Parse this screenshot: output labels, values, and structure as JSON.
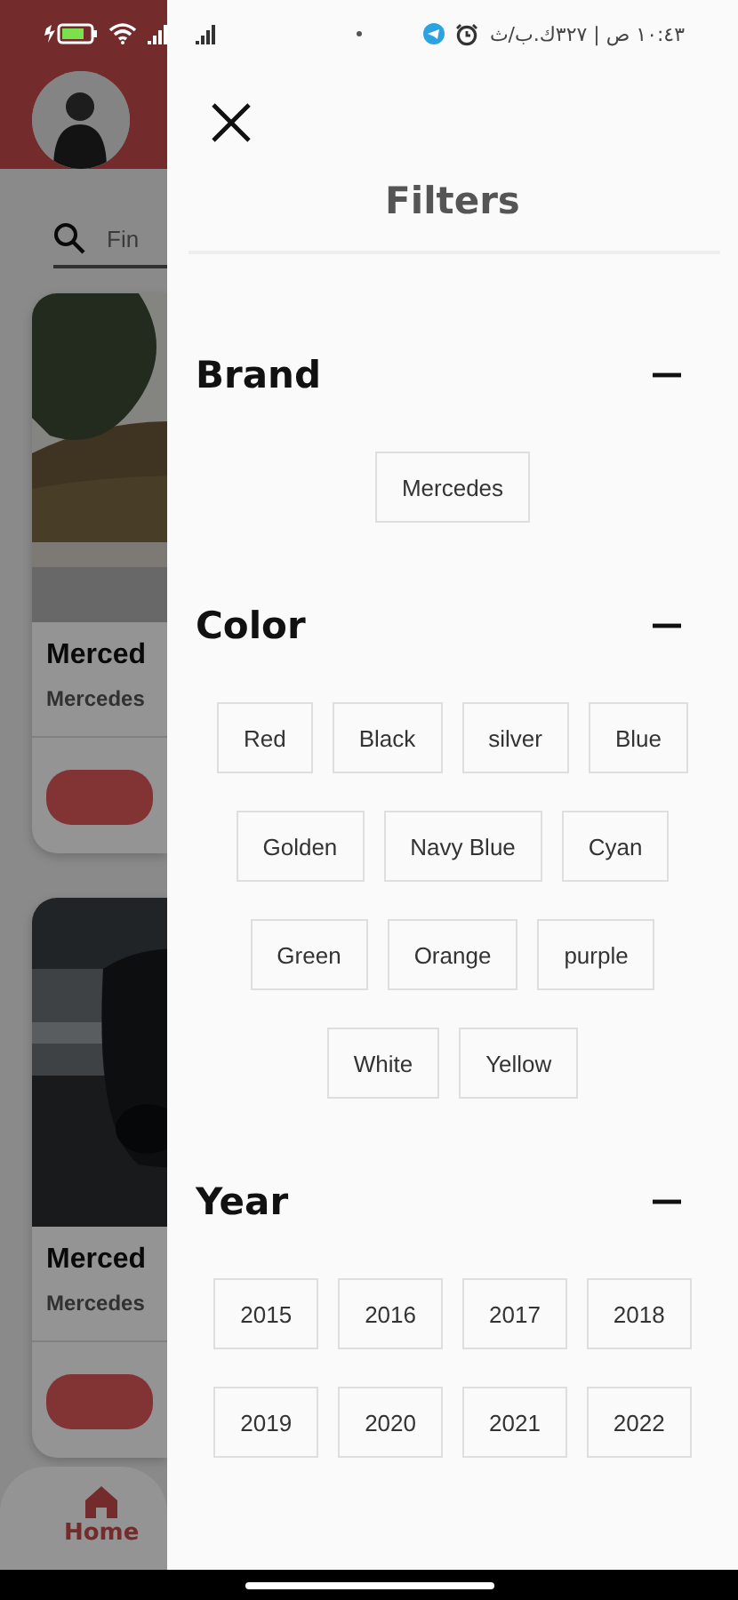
{
  "status_bar": {
    "network_speed": "١٠:٤٣ ص | ٣٢٧ك.ب/ث"
  },
  "background": {
    "search": {
      "placeholder": "Fin"
    },
    "cards": [
      {
        "kind": "trees",
        "title": "Merced",
        "subtitle": "Mercedes"
      },
      {
        "kind": "car",
        "title": "Merced",
        "subtitle": "Mercedes"
      }
    ],
    "nav": [
      {
        "label": "Home",
        "selected": true
      }
    ]
  },
  "filters": {
    "title": "Filters",
    "sections": [
      {
        "title": "Brand",
        "expanded": true,
        "options": [
          {
            "label": "Mercedes",
            "selected": false
          }
        ]
      },
      {
        "title": "Color",
        "expanded": true,
        "options": [
          {
            "label": "Red",
            "selected": false
          },
          {
            "label": "Black",
            "selected": false
          },
          {
            "label": "silver",
            "selected": false
          },
          {
            "label": "Blue",
            "selected": false
          },
          {
            "label": "Golden",
            "selected": false
          },
          {
            "label": "Navy Blue",
            "selected": false
          },
          {
            "label": "Cyan",
            "selected": false
          },
          {
            "label": "Green",
            "selected": false
          },
          {
            "label": "Orange",
            "selected": false
          },
          {
            "label": "purple",
            "selected": false
          },
          {
            "label": "White",
            "selected": false
          },
          {
            "label": "Yellow",
            "selected": false
          }
        ]
      },
      {
        "title": "Year",
        "expanded": true,
        "options": [
          {
            "label": "2015",
            "selected": false
          },
          {
            "label": "2016",
            "selected": false
          },
          {
            "label": "2017",
            "selected": false
          },
          {
            "label": "2018",
            "selected": false
          },
          {
            "label": "2019",
            "selected": false
          },
          {
            "label": "2020",
            "selected": false
          },
          {
            "label": "2021",
            "selected": false
          },
          {
            "label": "2022",
            "selected": false
          }
        ]
      }
    ]
  }
}
